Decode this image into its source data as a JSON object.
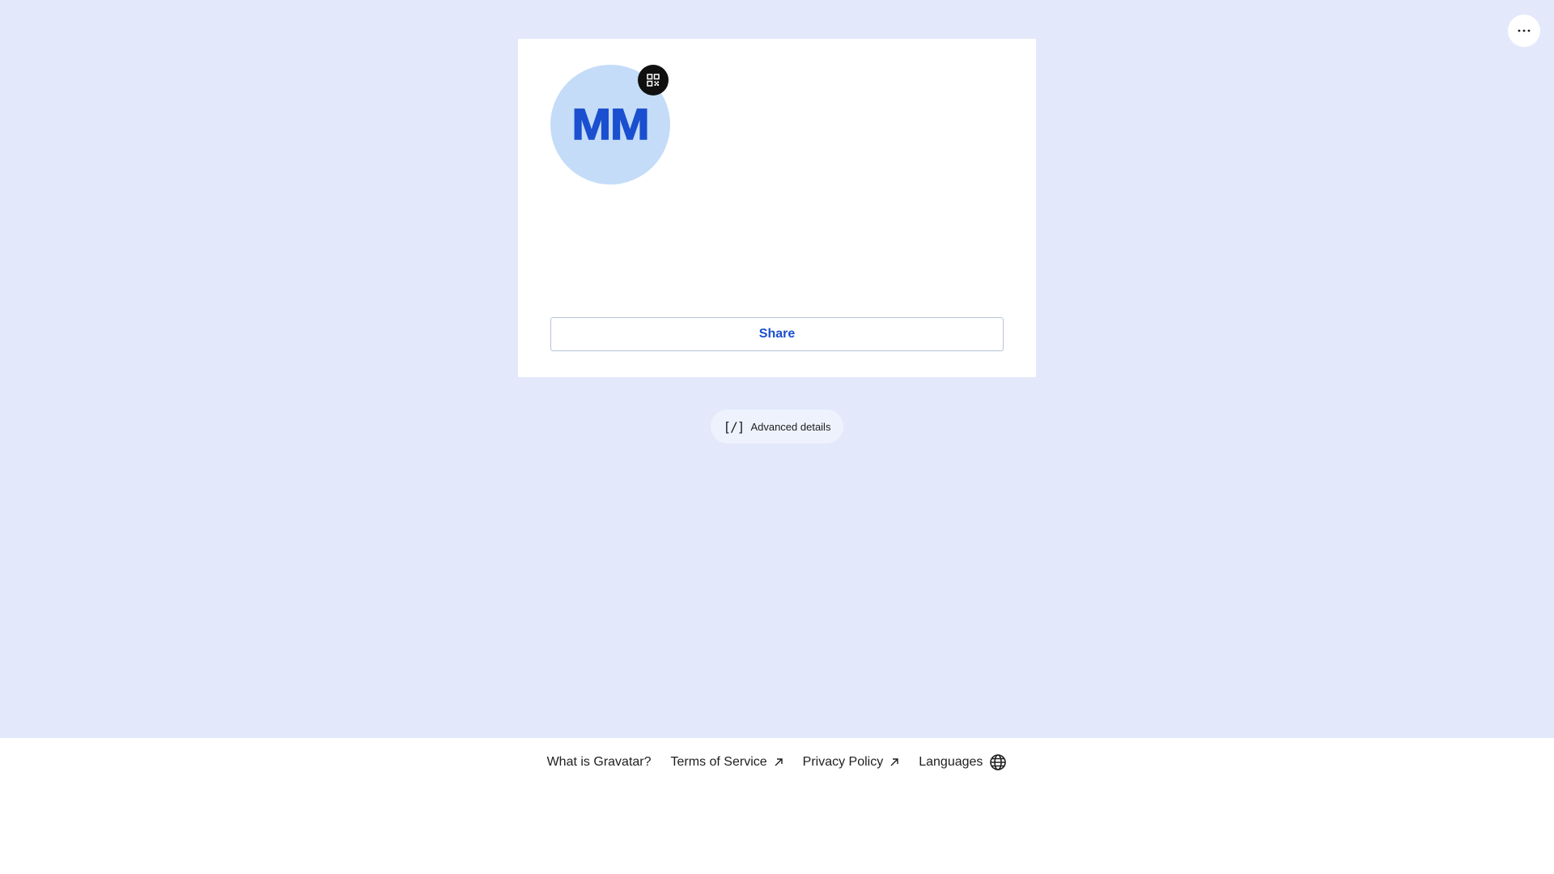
{
  "header": {
    "more_icon": "ellipsis-icon"
  },
  "profile_card": {
    "avatar_initials": "MM",
    "qr_icon": "qr-code-icon",
    "share_label": "Share"
  },
  "advanced": {
    "icon_text": "[/]",
    "label": "Advanced details"
  },
  "footer": {
    "links": [
      {
        "label": "What is Gravatar?",
        "icon": ""
      },
      {
        "label": "Terms of Service",
        "icon": "external-arrow-icon"
      },
      {
        "label": "Privacy Policy",
        "icon": "external-arrow-icon"
      },
      {
        "label": "Languages",
        "icon": "globe-icon"
      }
    ]
  },
  "colors": {
    "page_background": "#e3e9fb",
    "accent": "#1a4fcf",
    "avatar_background": "#c4dcf8"
  }
}
